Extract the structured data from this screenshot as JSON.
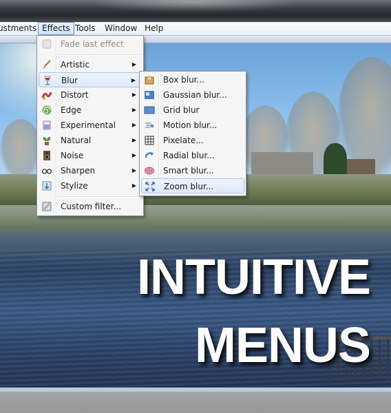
{
  "menubar": {
    "items": [
      {
        "label": "ustments"
      },
      {
        "label": "Effects"
      },
      {
        "label": "Tools"
      },
      {
        "label": "Window"
      },
      {
        "label": "Help"
      }
    ]
  },
  "effects_menu": {
    "fade_last": "Fade last effect",
    "items": [
      {
        "label": "Artistic",
        "icon": "paintbrush-icon"
      },
      {
        "label": "Blur",
        "icon": "glass-icon"
      },
      {
        "label": "Distort",
        "icon": "distort-icon"
      },
      {
        "label": "Edge",
        "icon": "spiral-icon"
      },
      {
        "label": "Experimental",
        "icon": "beaker-icon"
      },
      {
        "label": "Natural",
        "icon": "plant-icon"
      },
      {
        "label": "Noise",
        "icon": "speaker-icon"
      },
      {
        "label": "Sharpen",
        "icon": "glasses-icon"
      },
      {
        "label": "Stylize",
        "icon": "stylize-icon"
      }
    ],
    "custom_filter": "Custom filter..."
  },
  "blur_menu": {
    "items": [
      {
        "label": "Box blur...",
        "icon": "box-blur-icon"
      },
      {
        "label": "Gaussian blur...",
        "icon": "gaussian-blur-icon"
      },
      {
        "label": "Grid blur",
        "icon": "grid-blur-icon"
      },
      {
        "label": "Motion blur...",
        "icon": "motion-blur-icon"
      },
      {
        "label": "Pixelate...",
        "icon": "pixelate-icon"
      },
      {
        "label": "Radial blur...",
        "icon": "radial-blur-icon"
      },
      {
        "label": "Smart blur...",
        "icon": "brain-icon"
      },
      {
        "label": "Zoom blur...",
        "icon": "zoom-blur-icon"
      }
    ]
  },
  "overlay": {
    "line1": "INTUITIVE",
    "line2": "MENUS"
  },
  "colors": {
    "menu_highlight": "#dde9f8",
    "menu_highlight_border": "#a8c7ee"
  }
}
